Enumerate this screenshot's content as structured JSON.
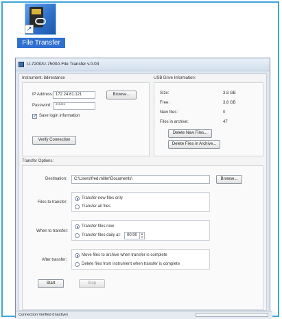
{
  "desktop": {
    "icon_label": "File Transfer"
  },
  "window": {
    "title": "U-7200/U-7500A File Transfer v.0.03"
  },
  "instrument": {
    "group_label": "Instrument: 8direstance",
    "ip_label": "IP Address:",
    "ip_value": "172.24.81.121",
    "browse_label": "Browse...",
    "password_label": "Password:",
    "password_value": "******",
    "save_login_label": "Save login information",
    "save_login_checked": true,
    "verify_label": "Verify Connection"
  },
  "usb": {
    "group_label": "USB Drive Information:",
    "rows": [
      {
        "label": "Size:",
        "value": "3.8 GB"
      },
      {
        "label": "Free:",
        "value": "3.8 GB"
      },
      {
        "label": "New files:",
        "value": "0"
      },
      {
        "label": "Files in archive:",
        "value": "47"
      }
    ],
    "delete_new_label": "Delete New Files...",
    "delete_archive_label": "Delete Files in Archive..."
  },
  "transfer": {
    "group_label": "Transfer Options:",
    "destination_label": "Destination:",
    "destination_value": "C:\\Users\\fred.miller\\Documents\\",
    "browse_label": "Browse...",
    "files_label": "Files to transfer:",
    "files_options": [
      "Transfer new files only",
      "Transfer all files"
    ],
    "when_label": "When to transfer:",
    "when_options": [
      "Transfer files now",
      "Transfer files daily at:"
    ],
    "daily_time": "00:00",
    "after_label": "After transfer:",
    "after_options": [
      "Move files to archive when transfer is complete",
      "Delete files from instrument when transfer is complete"
    ],
    "start_label": "Start",
    "stop_label": "Stop"
  },
  "status": {
    "text": "Connection Verified (Inactive)"
  },
  "colors": {
    "frame": "#3aa6d8",
    "icon_label_bg": "#2f6fd0"
  }
}
